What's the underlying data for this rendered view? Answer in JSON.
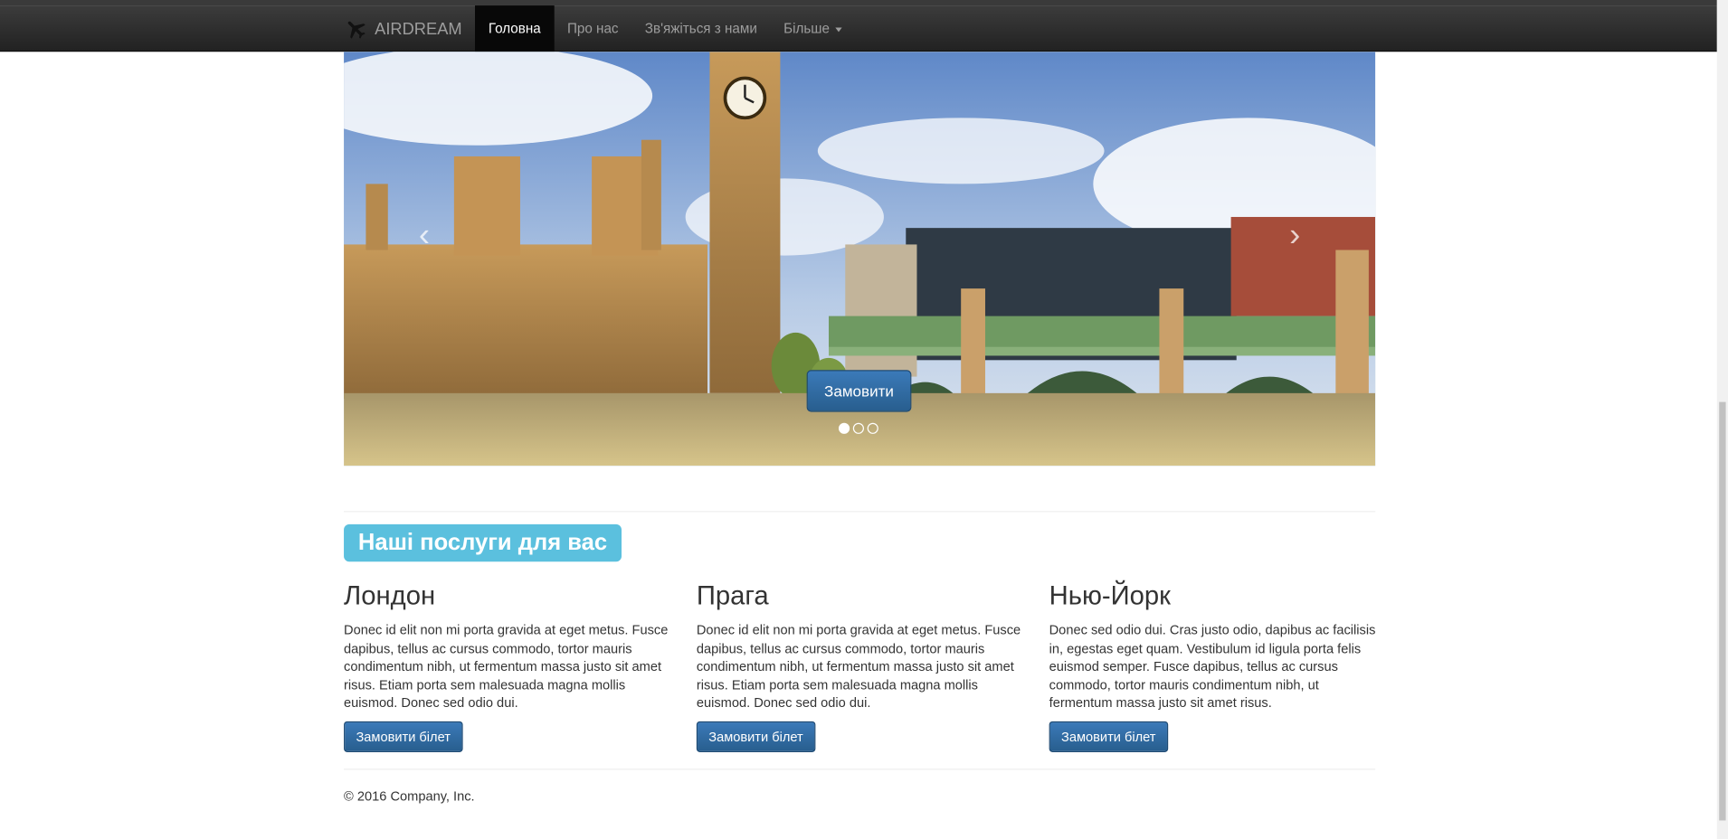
{
  "navbar": {
    "brand": "AIRDREAM",
    "brand_icon": "airplane-icon",
    "items": [
      {
        "label": "Головна",
        "active": true
      },
      {
        "label": "Про нас",
        "active": false
      },
      {
        "label": "Зв'яжіться з нами",
        "active": false
      },
      {
        "label": "Більше",
        "active": false,
        "dropdown": true
      }
    ]
  },
  "carousel": {
    "button_label": "Замовити",
    "prev_icon": "chevron-left-icon",
    "next_icon": "chevron-right-icon",
    "slide_count": 3,
    "active_slide": 1
  },
  "services": {
    "heading": "Наші послуги для вас",
    "cities": [
      {
        "name": "Лондон",
        "text": "Donec id elit non mi porta gravida at eget metus. Fusce dapibus, tellus ac cursus commodo, tortor mauris condimentum nibh, ut fermentum massa justo sit amet risus. Etiam porta sem malesuada magna mollis euismod. Donec sed odio dui.",
        "button": "Замовити білет"
      },
      {
        "name": "Прага",
        "text": "Donec id elit non mi porta gravida at eget metus. Fusce dapibus, tellus ac cursus commodo, tortor mauris condimentum nibh, ut fermentum massa justo sit amet risus. Etiam porta sem malesuada magna mollis euismod. Donec sed odio dui.",
        "button": "Замовити білет"
      },
      {
        "name": "Нью-Йорк",
        "text": "Donec sed odio dui. Cras justo odio, dapibus ac facilisis in, egestas eget quam. Vestibulum id ligula porta felis euismod semper. Fusce dapibus, tellus ac cursus commodo, tortor mauris condimentum nibh, ut fermentum massa justo sit amet risus.",
        "button": "Замовити білет"
      }
    ]
  },
  "footer": {
    "copyright": "© 2016 Company, Inc."
  },
  "colors": {
    "navbar_bg": "#222222",
    "primary_button": "#337ab7",
    "info_label": "#5bc0de"
  }
}
